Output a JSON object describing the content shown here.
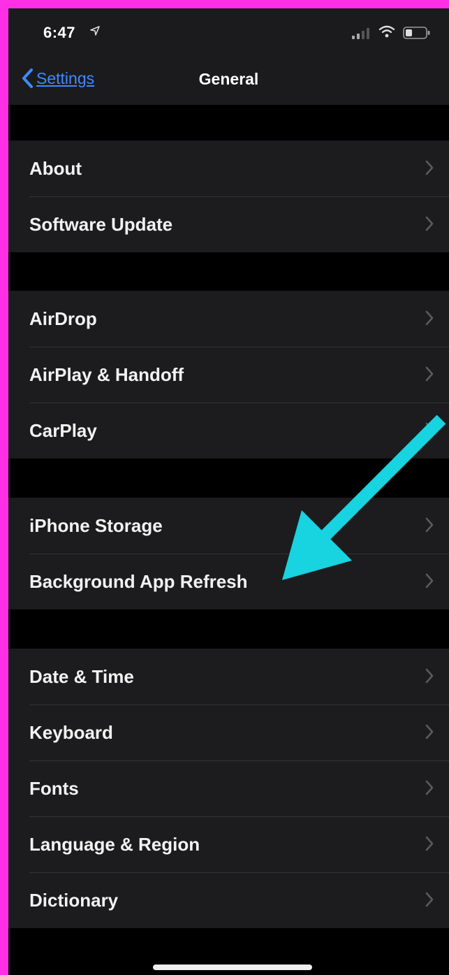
{
  "status_bar": {
    "time": "6:47",
    "icons": [
      "location-arrow-icon",
      "signal-icon",
      "wifi-icon",
      "battery-icon"
    ]
  },
  "nav": {
    "back_label": "Settings",
    "title": "General"
  },
  "groups": [
    {
      "items": [
        {
          "label": "About"
        },
        {
          "label": "Software Update"
        }
      ]
    },
    {
      "items": [
        {
          "label": "AirDrop"
        },
        {
          "label": "AirPlay & Handoff"
        },
        {
          "label": "CarPlay"
        }
      ]
    },
    {
      "items": [
        {
          "label": "iPhone Storage"
        },
        {
          "label": "Background App Refresh"
        }
      ]
    },
    {
      "items": [
        {
          "label": "Date & Time"
        },
        {
          "label": "Keyboard"
        },
        {
          "label": "Fonts"
        },
        {
          "label": "Language & Region"
        },
        {
          "label": "Dictionary"
        }
      ]
    }
  ],
  "colors": {
    "border_frame": "#ff2fe6",
    "background": "#000000",
    "cell_background": "#1c1c1e",
    "accent_link": "#3d8bff",
    "annotation_arrow": "#18d3e0"
  }
}
